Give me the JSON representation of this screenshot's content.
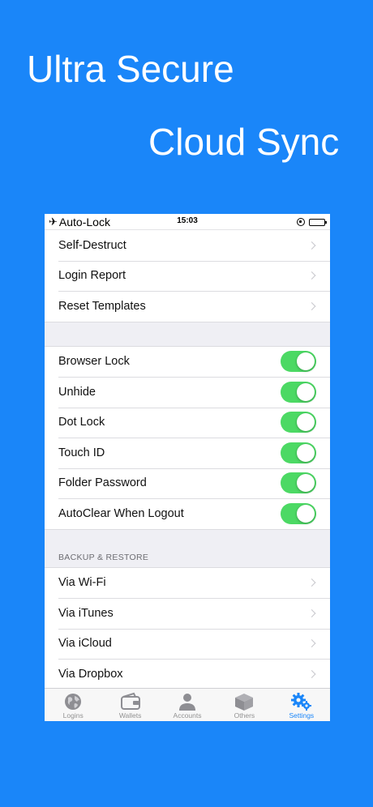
{
  "promo": {
    "line1": "Ultra Secure",
    "line2": "Cloud Sync"
  },
  "status_bar": {
    "left_label": "Auto-Lock",
    "time": "15:03"
  },
  "settings": {
    "group1": [
      {
        "label": "Self-Destruct"
      },
      {
        "label": "Login Report"
      },
      {
        "label": "Reset Templates"
      }
    ],
    "toggles": [
      {
        "label": "Browser Lock",
        "on": true
      },
      {
        "label": "Unhide",
        "on": true
      },
      {
        "label": "Dot Lock",
        "on": true
      },
      {
        "label": "Touch ID",
        "on": true
      },
      {
        "label": "Folder Password",
        "on": true
      },
      {
        "label": "AutoClear When Logout",
        "on": true
      }
    ],
    "backup_header": "BACKUP & RESTORE",
    "backup": [
      {
        "label": "Via Wi-Fi"
      },
      {
        "label": "Via iTunes"
      },
      {
        "label": "Via iCloud"
      },
      {
        "label": "Via Dropbox"
      }
    ]
  },
  "tab_bar": {
    "items": [
      {
        "label": "Logins",
        "icon": "globe-icon"
      },
      {
        "label": "Wallets",
        "icon": "wallet-icon"
      },
      {
        "label": "Accounts",
        "icon": "person-icon"
      },
      {
        "label": "Others",
        "icon": "box-icon"
      },
      {
        "label": "Settings",
        "icon": "gears-icon",
        "active": true
      }
    ]
  },
  "colors": {
    "background": "#1a86f9",
    "toggle_on": "#4cd964",
    "tab_active": "#1a86f9",
    "tab_inactive": "#929292"
  }
}
